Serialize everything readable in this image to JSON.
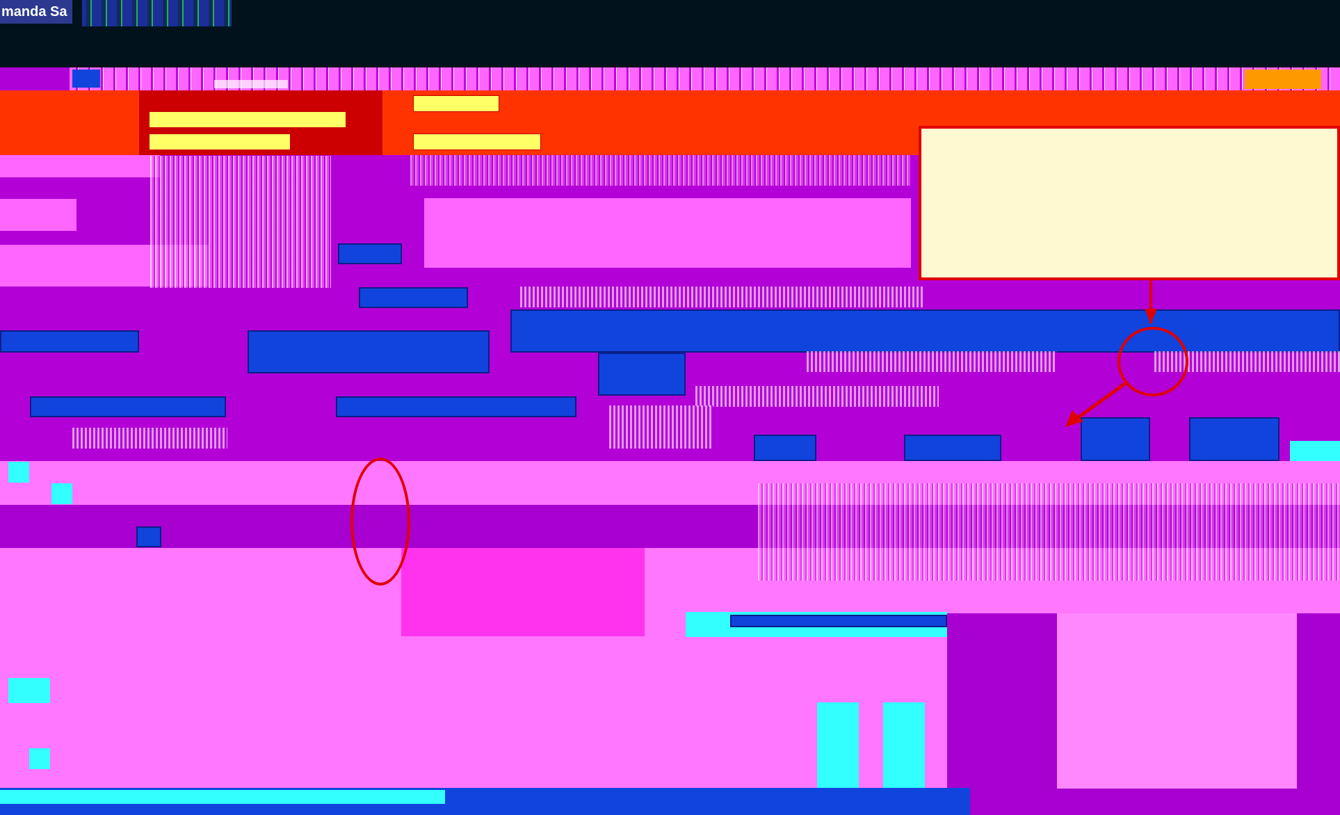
{
  "header": {
    "user_name": "manda Sa",
    "nav_label": ""
  },
  "orange_bar": {
    "buttons": [
      "",
      "",
      "",
      ""
    ]
  },
  "callout": {
    "text": ""
  },
  "table": {
    "column_labels": [
      "",
      "",
      ""
    ]
  },
  "footer": {
    "text": ""
  },
  "colors": {
    "topbar": "#02121c",
    "accent_orange": "#ff3300",
    "purple": "#b300d6",
    "pink": "#ff66ff",
    "blue": "#1144dd",
    "annotation_red": "#e00000",
    "callout_fill": "#fff9d2"
  }
}
